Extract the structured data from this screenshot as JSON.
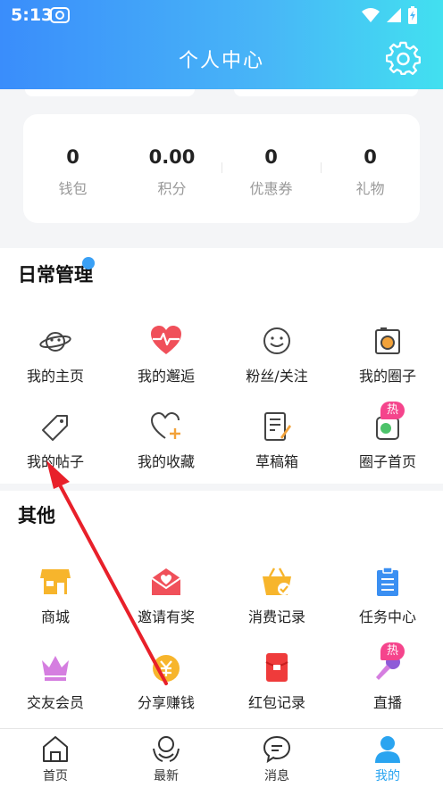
{
  "status": {
    "time": "5:13"
  },
  "header": {
    "title": "个人中心"
  },
  "stats": [
    {
      "value": "0",
      "label": "钱包"
    },
    {
      "value": "0.00",
      "label": "积分"
    },
    {
      "value": "0",
      "label": "优惠券"
    },
    {
      "value": "0",
      "label": "礼物"
    }
  ],
  "daily": {
    "title": "日常管理",
    "items": [
      {
        "label": "我的主页",
        "icon": "planet-icon"
      },
      {
        "label": "我的邂逅",
        "icon": "heart-pulse-icon"
      },
      {
        "label": "粉丝/关注",
        "icon": "smile-icon"
      },
      {
        "label": "我的圈子",
        "icon": "camera-icon"
      },
      {
        "label": "我的帖子",
        "icon": "tag-icon"
      },
      {
        "label": "我的收藏",
        "icon": "heart-plus-icon"
      },
      {
        "label": "草稿箱",
        "icon": "document-edit-icon"
      },
      {
        "label": "圈子首页",
        "icon": "circle-home-icon",
        "badge": "热"
      }
    ]
  },
  "other": {
    "title": "其他",
    "items": [
      {
        "label": "商城",
        "icon": "shop-icon"
      },
      {
        "label": "邀请有奖",
        "icon": "envelope-heart-icon"
      },
      {
        "label": "消费记录",
        "icon": "basket-icon"
      },
      {
        "label": "任务中心",
        "icon": "clipboard-icon"
      },
      {
        "label": "交友会员",
        "icon": "crown-icon"
      },
      {
        "label": "分享赚钱",
        "icon": "coin-icon"
      },
      {
        "label": "红包记录",
        "icon": "red-envelope-icon"
      },
      {
        "label": "直播",
        "icon": "microphone-icon",
        "badge": "热"
      }
    ]
  },
  "tabs": [
    {
      "label": "首页",
      "icon": "home-icon"
    },
    {
      "label": "最新",
      "icon": "hands-icon"
    },
    {
      "label": "消息",
      "icon": "chat-icon"
    },
    {
      "label": "我的",
      "icon": "user-icon",
      "active": true
    }
  ],
  "colors": {
    "accent": "#2aa4f0",
    "hot": "#f5448c",
    "arrow": "#e8202a"
  }
}
